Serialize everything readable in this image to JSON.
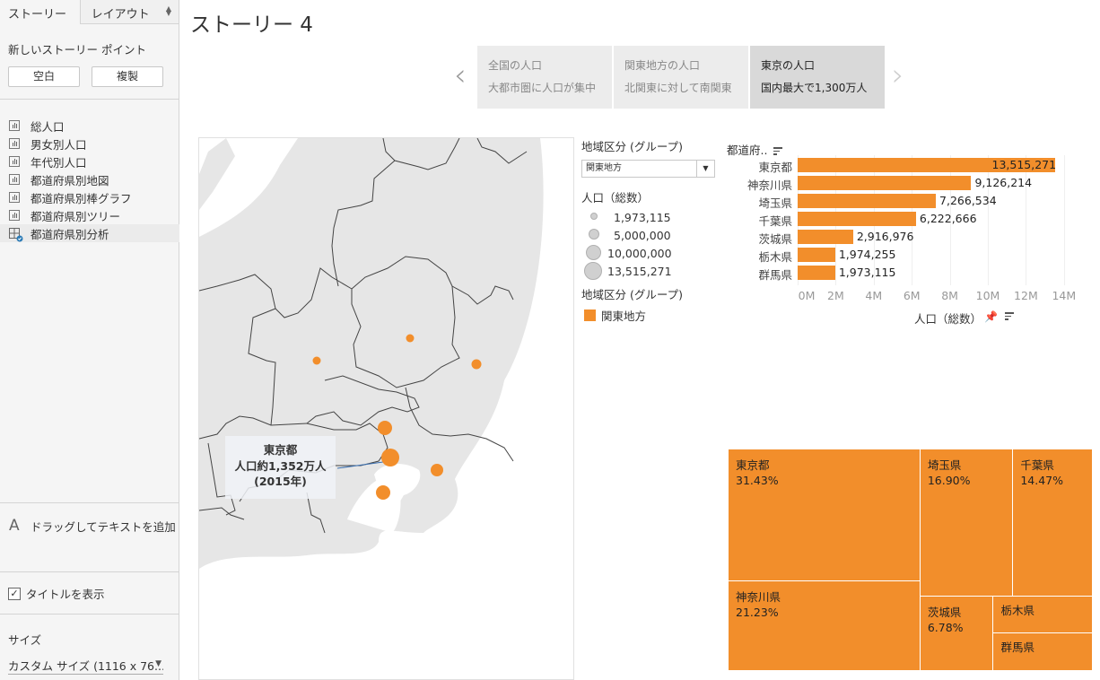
{
  "sidebar": {
    "tabs": [
      {
        "label": "ストーリー"
      },
      {
        "label": "レイアウト"
      }
    ],
    "new_point_label": "新しいストーリー ポイント",
    "blank_button": "空白",
    "duplicate_button": "複製",
    "sheets": [
      {
        "label": "総人口",
        "icon": "worksheet-icon"
      },
      {
        "label": "男女別人口",
        "icon": "worksheet-icon"
      },
      {
        "label": "年代別人口",
        "icon": "worksheet-icon"
      },
      {
        "label": "都道府県別地図",
        "icon": "worksheet-icon"
      },
      {
        "label": "都道府県別棒グラフ",
        "icon": "worksheet-icon"
      },
      {
        "label": "都道府県別ツリー",
        "icon": "worksheet-icon"
      },
      {
        "label": "都道府県別分析",
        "icon": "dashboard-icon",
        "selected": true
      }
    ],
    "drag_text": "ドラッグしてテキストを追加",
    "show_title_label": "タイトルを表示",
    "show_title_checked": true,
    "size_label": "サイズ",
    "size_value": "カスタム サイズ (1116 x 76..."
  },
  "story": {
    "title": "ストーリー 4",
    "points": [
      {
        "title": "全国の人口",
        "caption": "大都市圏に人口が集中",
        "active": false
      },
      {
        "title": "関東地方の人口",
        "caption": "北関東に対して南関東",
        "active": false
      },
      {
        "title": "東京の人口",
        "caption": "国内最大で1,300万人",
        "active": true
      }
    ]
  },
  "map": {
    "annotation": {
      "line1": "東京都",
      "line2": "人口約1,352万人",
      "line3": "(2015年)"
    },
    "marker_color": "#f28e2b",
    "points": [
      {
        "name": "群馬県",
        "value": 1973115
      },
      {
        "name": "栃木県",
        "value": 1974255
      },
      {
        "name": "茨城県",
        "value": 2916976
      },
      {
        "name": "埼玉県",
        "value": 7266534
      },
      {
        "name": "東京都",
        "value": 13515271
      },
      {
        "name": "千葉県",
        "value": 6222666
      },
      {
        "name": "神奈川県",
        "value": 9126214
      }
    ]
  },
  "legend": {
    "filter_title": "地域区分 (グループ)",
    "filter_value": "関東地方",
    "size_title": "人口（総数）",
    "size_items": [
      "1,973,115",
      "5,000,000",
      "10,000,000",
      "13,515,271"
    ],
    "color_title": "地域区分 (グループ)",
    "color_items": [
      {
        "label": "関東地方",
        "color": "#f28e2b"
      }
    ]
  },
  "chart_data": [
    {
      "type": "bar",
      "orientation": "horizontal",
      "row_header": "都道府..",
      "categories": [
        "東京都",
        "神奈川県",
        "埼玉県",
        "千葉県",
        "茨城県",
        "栃木県",
        "群馬県"
      ],
      "values": [
        13515271,
        9126214,
        7266534,
        6222666,
        2916976,
        1974255,
        1973115
      ],
      "value_labels": [
        "13,515,271",
        "9,126,214",
        "7,266,534",
        "6,222,666",
        "2,916,976",
        "1,974,255",
        "1,973,115"
      ],
      "xlabel": "人口（総数）",
      "xticks": [
        "0M",
        "2M",
        "4M",
        "6M",
        "8M",
        "10M",
        "12M",
        "14M"
      ],
      "xlim": [
        0,
        15500000
      ],
      "color": "#f28e2b",
      "grid": true
    },
    {
      "type": "treemap",
      "items": [
        {
          "name": "東京都",
          "pct": "31.43%",
          "value": 31.43
        },
        {
          "name": "神奈川県",
          "pct": "21.23%",
          "value": 21.23
        },
        {
          "name": "埼玉県",
          "pct": "16.90%",
          "value": 16.9
        },
        {
          "name": "千葉県",
          "pct": "14.47%",
          "value": 14.47
        },
        {
          "name": "茨城県",
          "pct": "6.78%",
          "value": 6.78
        },
        {
          "name": "栃木県",
          "pct": "",
          "value": 4.59
        },
        {
          "name": "群馬県",
          "pct": "",
          "value": 4.59
        }
      ],
      "color": "#f28e2b"
    }
  ]
}
